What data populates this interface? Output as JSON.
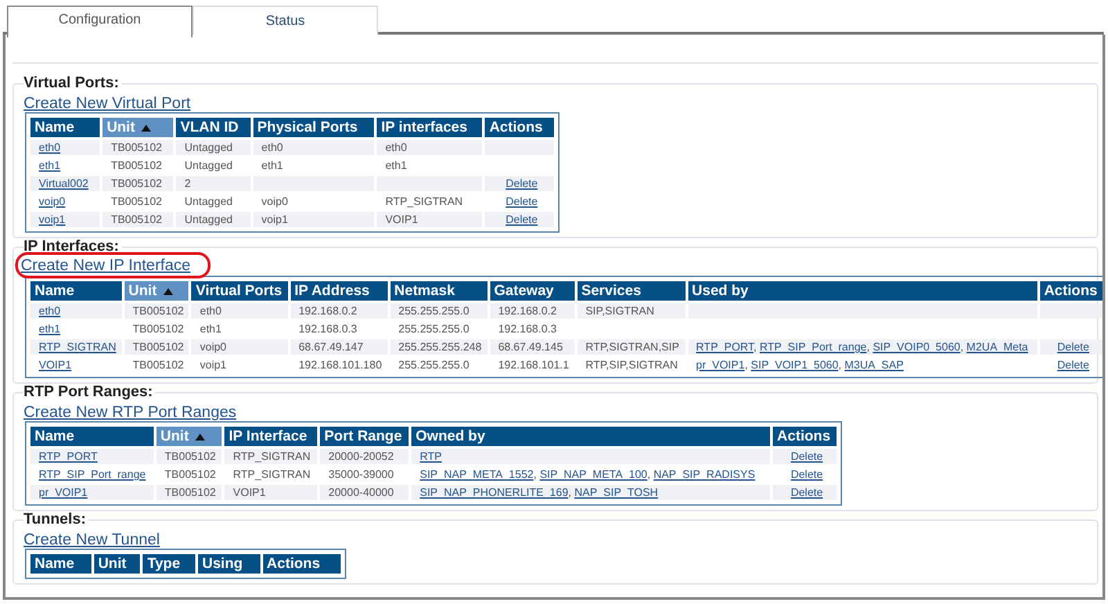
{
  "tabs": [
    {
      "label": "Configuration",
      "selected": true
    },
    {
      "label": "Status",
      "selected": false
    }
  ],
  "sections": [
    {
      "title": "Virtual Ports:",
      "create_link": {
        "text": "Create New Virtual Port",
        "highlighted": false
      },
      "table": {
        "columns": [
          {
            "label": "Name",
            "sorted": false
          },
          {
            "label": "Unit",
            "sorted": true
          },
          {
            "label": "VLAN ID",
            "sorted": false
          },
          {
            "label": "Physical Ports",
            "sorted": false
          },
          {
            "label": "IP interfaces",
            "sorted": false
          },
          {
            "label": "Actions",
            "sorted": false
          }
        ],
        "rows": [
          [
            {
              "kind": "link",
              "text": "eth0"
            },
            {
              "kind": "text",
              "text": "TB005102"
            },
            {
              "kind": "text",
              "text": "Untagged"
            },
            {
              "kind": "text",
              "text": "eth0"
            },
            {
              "kind": "text",
              "text": "eth0"
            },
            null
          ],
          [
            {
              "kind": "link",
              "text": "eth1"
            },
            {
              "kind": "text",
              "text": "TB005102"
            },
            {
              "kind": "text",
              "text": "Untagged"
            },
            {
              "kind": "text",
              "text": "eth1"
            },
            {
              "kind": "text",
              "text": "eth1"
            },
            null
          ],
          [
            {
              "kind": "link",
              "text": "Virtual002"
            },
            {
              "kind": "text",
              "text": "TB005102"
            },
            {
              "kind": "text",
              "text": "2"
            },
            null,
            null,
            {
              "kind": "action",
              "text": "Delete"
            }
          ],
          [
            {
              "kind": "link",
              "text": "voip0"
            },
            {
              "kind": "text",
              "text": "TB005102"
            },
            {
              "kind": "text",
              "text": "Untagged"
            },
            {
              "kind": "text",
              "text": "voip0"
            },
            {
              "kind": "text",
              "text": "RTP_SIGTRAN"
            },
            {
              "kind": "action",
              "text": "Delete"
            }
          ],
          [
            {
              "kind": "link",
              "text": "voip1"
            },
            {
              "kind": "text",
              "text": "TB005102"
            },
            {
              "kind": "text",
              "text": "Untagged"
            },
            {
              "kind": "text",
              "text": "voip1"
            },
            {
              "kind": "text",
              "text": "VOIP1"
            },
            {
              "kind": "action",
              "text": "Delete"
            }
          ]
        ]
      }
    },
    {
      "title": "IP Interfaces:",
      "create_link": {
        "text": "Create New IP Interface",
        "highlighted": true
      },
      "table": {
        "columns": [
          {
            "label": "Name",
            "sorted": false
          },
          {
            "label": "Unit",
            "sorted": true
          },
          {
            "label": "Virtual Ports",
            "sorted": false
          },
          {
            "label": "IP Address",
            "sorted": false
          },
          {
            "label": "Netmask",
            "sorted": false
          },
          {
            "label": "Gateway",
            "sorted": false
          },
          {
            "label": "Services",
            "sorted": false
          },
          {
            "label": "Used by",
            "sorted": false
          },
          {
            "label": "Actions",
            "sorted": false
          }
        ],
        "rows": [
          [
            {
              "kind": "link",
              "text": "eth0"
            },
            {
              "kind": "text",
              "text": "TB005102"
            },
            {
              "kind": "text",
              "text": "eth0"
            },
            {
              "kind": "text",
              "text": "192.168.0.2"
            },
            {
              "kind": "text",
              "text": "255.255.255.0"
            },
            {
              "kind": "text",
              "text": "192.168.0.2"
            },
            {
              "kind": "text",
              "text": "SIP,SIGTRAN"
            },
            null,
            null
          ],
          [
            {
              "kind": "link",
              "text": "eth1"
            },
            {
              "kind": "text",
              "text": "TB005102"
            },
            {
              "kind": "text",
              "text": "eth1"
            },
            {
              "kind": "text",
              "text": "192.168.0.3"
            },
            {
              "kind": "text",
              "text": "255.255.255.0"
            },
            {
              "kind": "text",
              "text": "192.168.0.3"
            },
            null,
            null,
            null
          ],
          [
            {
              "kind": "link",
              "text": "RTP_SIGTRAN"
            },
            {
              "kind": "text",
              "text": "TB005102"
            },
            {
              "kind": "text",
              "text": "voip0"
            },
            {
              "kind": "text",
              "text": "68.67.49.147"
            },
            {
              "kind": "text",
              "text": "255.255.255.248"
            },
            {
              "kind": "text",
              "text": "68.67.49.145"
            },
            {
              "kind": "text",
              "text": "RTP,SIGTRAN,SIP"
            },
            {
              "kind": "links",
              "items": [
                "RTP_PORT",
                "RTP_SIP_Port_range",
                "SIP_VOIP0_5060",
                "M2UA_Meta"
              ],
              "separator": ", "
            },
            {
              "kind": "action",
              "text": "Delete"
            }
          ],
          [
            {
              "kind": "link",
              "text": "VOIP1"
            },
            {
              "kind": "text",
              "text": "TB005102"
            },
            {
              "kind": "text",
              "text": "voip1"
            },
            {
              "kind": "text",
              "text": "192.168.101.180"
            },
            {
              "kind": "text",
              "text": "255.255.255.0"
            },
            {
              "kind": "text",
              "text": "192.168.101.1"
            },
            {
              "kind": "text",
              "text": "RTP,SIP,SIGTRAN"
            },
            {
              "kind": "links",
              "items": [
                "pr_VOIP1",
                "SIP_VOIP1_5060",
                "M3UA_SAP"
              ],
              "separator": ", "
            },
            {
              "kind": "action",
              "text": "Delete"
            }
          ]
        ]
      }
    },
    {
      "title": "RTP Port Ranges:",
      "create_link": {
        "text": "Create New RTP Port Ranges",
        "highlighted": false
      },
      "table": {
        "columns": [
          {
            "label": "Name",
            "sorted": false
          },
          {
            "label": "Unit",
            "sorted": true
          },
          {
            "label": "IP Interface",
            "sorted": false
          },
          {
            "label": "Port Range",
            "sorted": false
          },
          {
            "label": "Owned by",
            "sorted": false
          },
          {
            "label": "Actions",
            "sorted": false
          }
        ],
        "rows": [
          [
            {
              "kind": "link",
              "text": "RTP_PORT"
            },
            {
              "kind": "text",
              "text": "TB005102"
            },
            {
              "kind": "text",
              "text": "RTP_SIGTRAN"
            },
            {
              "kind": "text",
              "text": "20000-20052"
            },
            {
              "kind": "links",
              "items": [
                "RTP"
              ]
            },
            {
              "kind": "action",
              "text": "Delete"
            }
          ],
          [
            {
              "kind": "link",
              "text": "RTP_SIP_Port_range"
            },
            {
              "kind": "text",
              "text": "TB005102"
            },
            {
              "kind": "text",
              "text": "RTP_SIGTRAN"
            },
            {
              "kind": "text",
              "text": "35000-39000"
            },
            {
              "kind": "links",
              "items": [
                "SIP_NAP_META_1552",
                "SIP_NAP_META_100",
                "NAP_SIP_RADISYS"
              ],
              "separator": ", "
            },
            {
              "kind": "action",
              "text": "Delete"
            }
          ],
          [
            {
              "kind": "link",
              "text": "pr_VOIP1"
            },
            {
              "kind": "text",
              "text": "TB005102"
            },
            {
              "kind": "text",
              "text": "VOIP1"
            },
            {
              "kind": "text",
              "text": "20000-40000"
            },
            {
              "kind": "links",
              "items": [
                "SIP_NAP_PHONERLITE_169",
                "NAP_SIP_TOSH"
              ],
              "separator": ", "
            },
            {
              "kind": "action",
              "text": "Delete"
            }
          ]
        ]
      }
    },
    {
      "title": "Tunnels:",
      "create_link": {
        "text": "Create New Tunnel",
        "highlighted": false
      },
      "table": {
        "columns": [
          {
            "label": "Name",
            "sorted": false
          },
          {
            "label": "Unit",
            "sorted": false
          },
          {
            "label": "Type",
            "sorted": false
          },
          {
            "label": "Using",
            "sorted": false
          },
          {
            "label": "Actions",
            "sorted": false
          }
        ]
      }
    }
  ]
}
